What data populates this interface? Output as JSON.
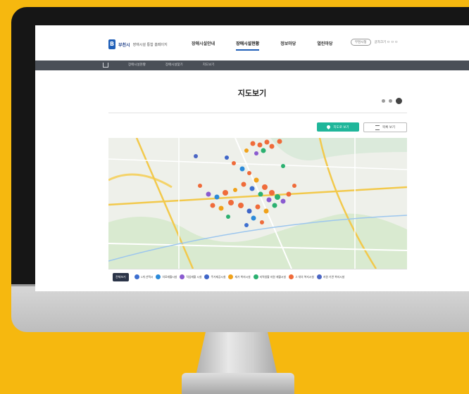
{
  "header": {
    "logo_name": "부천시",
    "logo_sub": "장애시설 통합 홈페이지",
    "logo_mark": "B",
    "nav": [
      "장애시설안내",
      "장애시설현황",
      "정보마당",
      "열린마당"
    ],
    "active_nav": 1,
    "util_pill": "부천시청",
    "util_text": "글자크기 ㅁ ㅁ ㅁ"
  },
  "subbar": {
    "crumbs": [
      "장애시설현황",
      "장애시설찾기",
      "지도보기"
    ]
  },
  "page": {
    "title": "지도보기"
  },
  "view_buttons": {
    "map_label": "지도로 보기",
    "list_label": "목록 보기"
  },
  "legend": {
    "title": "전체보기",
    "items": [
      {
        "label": "1개 선택시",
        "color": "#3d6fd0"
      },
      {
        "label": "의료재활시설",
        "color": "#2b8ad9"
      },
      {
        "label": "직업재활 시설",
        "color": "#8a5bd0"
      },
      {
        "label": "주거제공시설",
        "color": "#3f66c8"
      },
      {
        "label": "재가 복지시설",
        "color": "#f0a21a"
      },
      {
        "label": "지역생활 지원 재활시설",
        "color": "#2bb070"
      },
      {
        "label": "그 밖의 복지시설",
        "color": "#ef6b3a"
      },
      {
        "label": "지원 기관 복지시설",
        "color": "#4b66c4"
      }
    ]
  },
  "colors": {
    "accent": "#1fb69a",
    "brand": "#1f5fb8",
    "monitor_bg": "#F6B80F"
  }
}
